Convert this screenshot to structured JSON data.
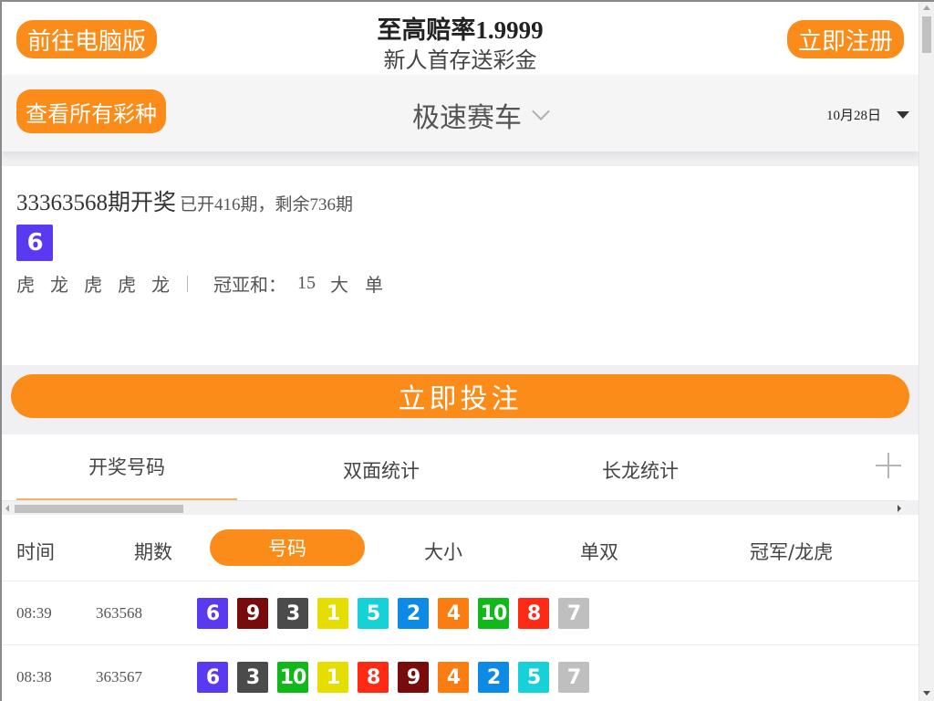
{
  "header": {
    "desktop_button": "前往电脑版",
    "register_button": "立即注册",
    "promo_title": "至高赔率1.9999",
    "promo_subtitle": "新人首存送彩金"
  },
  "subheader": {
    "all_lotteries_button": "查看所有彩种",
    "lottery_name": "极速赛车",
    "date": "10月28日"
  },
  "draw": {
    "issue": "33363568",
    "issue_suffix": "期开奖",
    "progress": "已开416期，剩余736期",
    "ball": "6",
    "ball_color": "#5a3af0",
    "dragon_tiger": [
      "虎",
      "龙",
      "虎",
      "虎",
      "龙"
    ],
    "sum_label": "冠亚和：",
    "sum_value": "15",
    "sum_size": "大",
    "sum_parity": "单"
  },
  "bet_button": "立即投注",
  "tabs": [
    {
      "label": "开奖号码",
      "active": true
    },
    {
      "label": "双面统计",
      "active": false
    },
    {
      "label": "长龙统计",
      "active": false
    }
  ],
  "history": {
    "columns": [
      "时间",
      "期数",
      "号码",
      "大小",
      "单双",
      "冠军/龙虎"
    ],
    "active_column": "号码",
    "rows": [
      {
        "time": "08:39",
        "issue": "363568",
        "balls": [
          "6",
          "9",
          "3",
          "1",
          "5",
          "2",
          "4",
          "10",
          "8",
          "7"
        ]
      },
      {
        "time": "08:38",
        "issue": "363567",
        "balls": [
          "6",
          "3",
          "10",
          "1",
          "8",
          "9",
          "4",
          "2",
          "5",
          "7"
        ]
      }
    ]
  },
  "ball_colors": {
    "1": "#e6de00",
    "2": "#0d8ae6",
    "3": "#4b4b4b",
    "4": "#fb7d12",
    "5": "#17d1d8",
    "6": "#5a3af0",
    "7": "#bfbfbf",
    "8": "#ff2a16",
    "9": "#780b0b",
    "10": "#10b81a"
  },
  "accent_color": "#fb8c1a"
}
